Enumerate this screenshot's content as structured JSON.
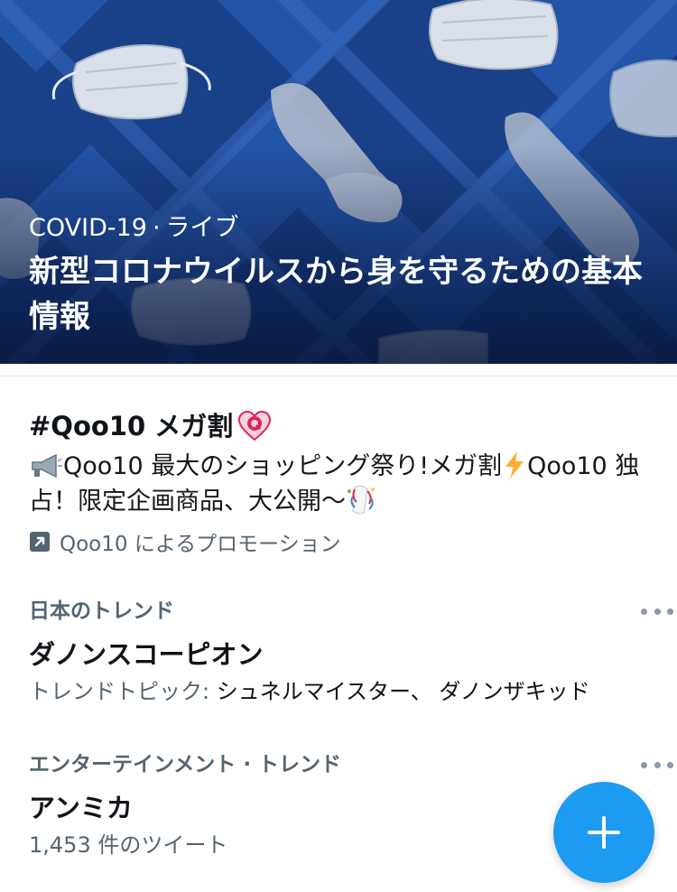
{
  "hero": {
    "category": "COVID-19",
    "separator": "·",
    "status": "ライブ",
    "title": "新型コロナウイルスから身を守るための基本情報"
  },
  "promoted": {
    "hashtag": "#Qoo10 メガ割",
    "hashtag_emoji": "heart-q-logo-icon",
    "description_text": "Qoo10 最大のショッピング祭り!メガ割",
    "description_text_2": "Qoo10 独占！限定企画商品、大公開〜",
    "description_icons": [
      "megaphone-icon",
      "lightning-icon",
      "party-popper-icon"
    ],
    "promo_label": "Qoo10 によるプロモーション",
    "promo_icon": "promoted-arrow-icon"
  },
  "trends": [
    {
      "context": "日本のトレンド",
      "name": "ダノンスコーピオン",
      "sub_prefix": "トレンドトピック: ",
      "sub_topics": "シュネルマイスター、 ダノンザキッド"
    },
    {
      "context": "エンターテインメント · トレンド",
      "name": "アンミカ",
      "sub_prefix": "1,453 件のツイート",
      "sub_topics": ""
    }
  ],
  "colors": {
    "accent": "#1d9bf0",
    "hero_bg": "#1f4fa0",
    "secondary_text": "#536471"
  },
  "fab_icon": "compose-plus-icon"
}
